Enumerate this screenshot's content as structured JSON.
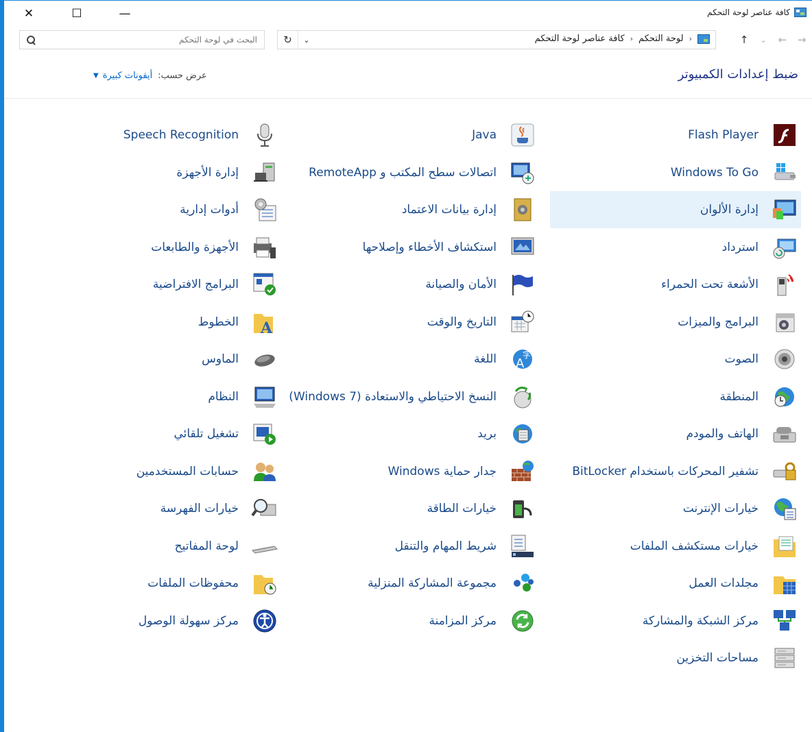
{
  "window": {
    "title": "كافة عناصر لوحة التحكم",
    "close_glyph": "✕",
    "maximize_glyph": "☐",
    "minimize_glyph": "—"
  },
  "nav": {
    "search_placeholder": "البحث في لوحة التحكم",
    "breadcrumbs": [
      "لوحة التحكم",
      "كافة عناصر لوحة التحكم"
    ],
    "crumb_sep": "‹",
    "refresh_glyph": "↻",
    "dropdown_glyph": "⌄",
    "back_glyph": "→",
    "forward_glyph": "←",
    "recent_glyph": "⌄",
    "up_glyph": "↑"
  },
  "header": {
    "title": "ضبط إعدادات الكمبيوتر",
    "view_by_label": "عرض حسب:",
    "view_by_value": "أيقونات كبيرة",
    "view_by_caret": "▼"
  },
  "items": [
    {
      "label": "Flash Player",
      "icon": "flash-player-icon",
      "col": 1,
      "row": 0
    },
    {
      "label": "Windows To Go",
      "icon": "windows-to-go-icon",
      "col": 1,
      "row": 1
    },
    {
      "label": "إدارة الألوان",
      "icon": "color-management-icon",
      "col": 1,
      "row": 2,
      "selected": true
    },
    {
      "label": "استرداد",
      "icon": "recovery-icon",
      "col": 1,
      "row": 3
    },
    {
      "label": "الأشعة تحت الحمراء",
      "icon": "infrared-icon",
      "col": 1,
      "row": 4
    },
    {
      "label": "البرامج والميزات",
      "icon": "programs-features-icon",
      "col": 1,
      "row": 5
    },
    {
      "label": "الصوت",
      "icon": "sound-icon",
      "col": 1,
      "row": 6
    },
    {
      "label": "المنطقة",
      "icon": "region-icon",
      "col": 1,
      "row": 7
    },
    {
      "label": "الهاتف والمودم",
      "icon": "phone-modem-icon",
      "col": 1,
      "row": 8
    },
    {
      "label": "تشفير المحركات باستخدام BitLocker",
      "icon": "bitlocker-icon",
      "col": 1,
      "row": 9
    },
    {
      "label": "خيارات الإنترنت",
      "icon": "internet-options-icon",
      "col": 1,
      "row": 10
    },
    {
      "label": "خيارات مستكشف الملفات",
      "icon": "file-explorer-options-icon",
      "col": 1,
      "row": 11
    },
    {
      "label": "مجلدات العمل",
      "icon": "work-folders-icon",
      "col": 1,
      "row": 12
    },
    {
      "label": "مركز الشبكة والمشاركة",
      "icon": "network-sharing-icon",
      "col": 1,
      "row": 13
    },
    {
      "label": "مساحات التخزين",
      "icon": "storage-spaces-icon",
      "col": 1,
      "row": 14
    },
    {
      "label": "Java",
      "icon": "java-icon",
      "col": 2,
      "row": 0
    },
    {
      "label": "اتصالات سطح المكتب و RemoteApp",
      "icon": "remoteapp-icon",
      "col": 2,
      "row": 1
    },
    {
      "label": "إدارة بيانات الاعتماد",
      "icon": "credential-manager-icon",
      "col": 2,
      "row": 2
    },
    {
      "label": "استكشاف الأخطاء وإصلاحها",
      "icon": "troubleshooting-icon",
      "col": 2,
      "row": 3
    },
    {
      "label": "الأمان والصيانة",
      "icon": "security-maintenance-icon",
      "col": 2,
      "row": 4
    },
    {
      "label": "التاريخ والوقت",
      "icon": "date-time-icon",
      "col": 2,
      "row": 5
    },
    {
      "label": "اللغة",
      "icon": "language-icon",
      "col": 2,
      "row": 6
    },
    {
      "label": "النسخ الاحتياطي والاستعادة (Windows 7)",
      "icon": "backup-restore-icon",
      "col": 2,
      "row": 7
    },
    {
      "label": "بريد",
      "icon": "mail-icon",
      "col": 2,
      "row": 8
    },
    {
      "label": "جدار حماية Windows",
      "icon": "firewall-icon",
      "col": 2,
      "row": 9
    },
    {
      "label": "خيارات الطاقة",
      "icon": "power-options-icon",
      "col": 2,
      "row": 10
    },
    {
      "label": "شريط المهام والتنقل",
      "icon": "taskbar-navigation-icon",
      "col": 2,
      "row": 11
    },
    {
      "label": "مجموعة المشاركة المنزلية",
      "icon": "homegroup-icon",
      "col": 2,
      "row": 12
    },
    {
      "label": "مركز المزامنة",
      "icon": "sync-center-icon",
      "col": 2,
      "row": 13
    },
    {
      "label": "Speech Recognition",
      "icon": "speech-recognition-icon",
      "col": 3,
      "row": 0
    },
    {
      "label": "إدارة الأجهزة",
      "icon": "device-manager-icon",
      "col": 3,
      "row": 1
    },
    {
      "label": "أدوات إدارية",
      "icon": "administrative-tools-icon",
      "col": 3,
      "row": 2
    },
    {
      "label": "الأجهزة والطابعات",
      "icon": "devices-printers-icon",
      "col": 3,
      "row": 3
    },
    {
      "label": "البرامج الافتراضية",
      "icon": "default-programs-icon",
      "col": 3,
      "row": 4
    },
    {
      "label": "الخطوط",
      "icon": "fonts-icon",
      "col": 3,
      "row": 5
    },
    {
      "label": "الماوس",
      "icon": "mouse-icon",
      "col": 3,
      "row": 6
    },
    {
      "label": "النظام",
      "icon": "system-icon",
      "col": 3,
      "row": 7
    },
    {
      "label": "تشغيل تلقائي",
      "icon": "autoplay-icon",
      "col": 3,
      "row": 8
    },
    {
      "label": "حسابات المستخدمين",
      "icon": "user-accounts-icon",
      "col": 3,
      "row": 9
    },
    {
      "label": "خيارات الفهرسة",
      "icon": "indexing-options-icon",
      "col": 3,
      "row": 10
    },
    {
      "label": "لوحة المفاتيح",
      "icon": "keyboard-icon",
      "col": 3,
      "row": 11
    },
    {
      "label": "محفوظات الملفات",
      "icon": "file-history-icon",
      "col": 3,
      "row": 12
    },
    {
      "label": "مركز سهولة الوصول",
      "icon": "ease-of-access-icon",
      "col": 3,
      "row": 13
    }
  ]
}
